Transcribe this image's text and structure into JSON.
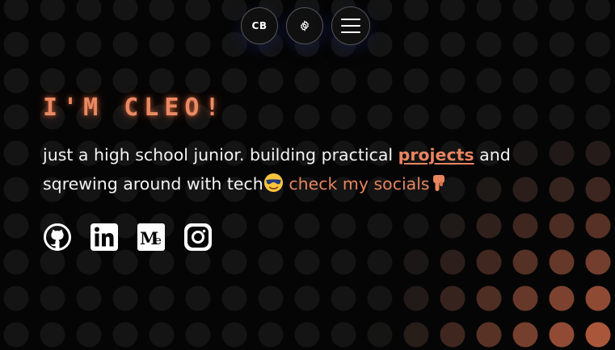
{
  "nav": {
    "logo": "CB",
    "settings_icon": "gear-icon",
    "menu_icon": "hamburger-menu-icon"
  },
  "hero": {
    "title": "I'M CLEO!",
    "bio_prefix": "just a high school junior. building practical",
    "projects_link": "projects",
    "bio_middle": "and sqrewing around with tech",
    "cool_emoji": "smiling-face-with-sunglasses",
    "socials_cta": "check my socials",
    "point_emoji": "hand-pointing-down"
  },
  "socials": [
    {
      "name": "github",
      "icon": "github-icon"
    },
    {
      "name": "linkedin",
      "icon": "linkedin-icon"
    },
    {
      "name": "medium",
      "icon": "medium-icon"
    },
    {
      "name": "instagram",
      "icon": "instagram-icon"
    }
  ],
  "colors": {
    "background": "#050505",
    "accent": "#ea8a64",
    "dot_dark": "#141414",
    "dot_warm": "#e36f4a"
  }
}
